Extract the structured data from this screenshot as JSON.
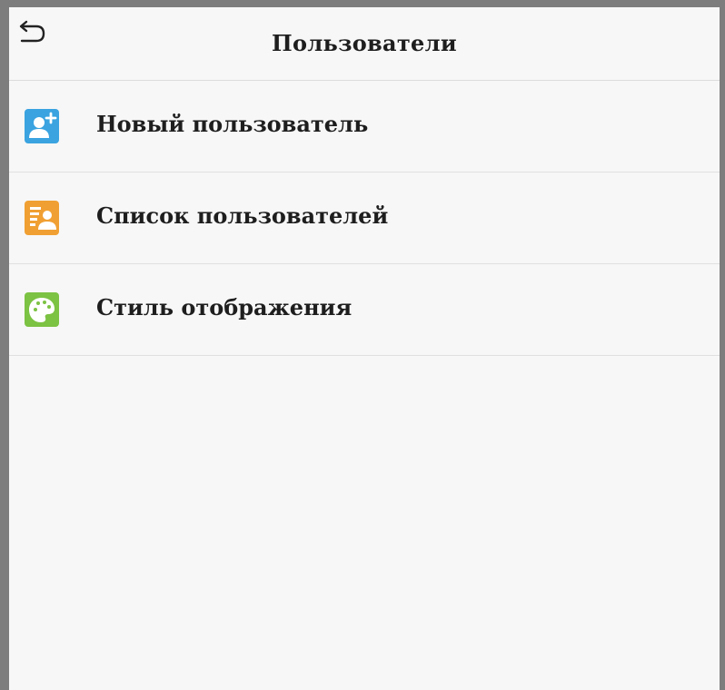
{
  "header": {
    "back_icon": "back-arrow-icon",
    "title": "Пользователи"
  },
  "menu": {
    "items": [
      {
        "label": "Новый пользователь",
        "icon": "add-user-icon",
        "color": "#3aa3e0"
      },
      {
        "label": "Список пользователей",
        "icon": "user-list-icon",
        "color": "#f0a033"
      },
      {
        "label": "Стиль отображения",
        "icon": "palette-icon",
        "color": "#7cc243"
      }
    ]
  },
  "colors": {
    "background": "#f7f7f7",
    "text": "#1e1e1e",
    "divider": "#e0e0e0"
  }
}
